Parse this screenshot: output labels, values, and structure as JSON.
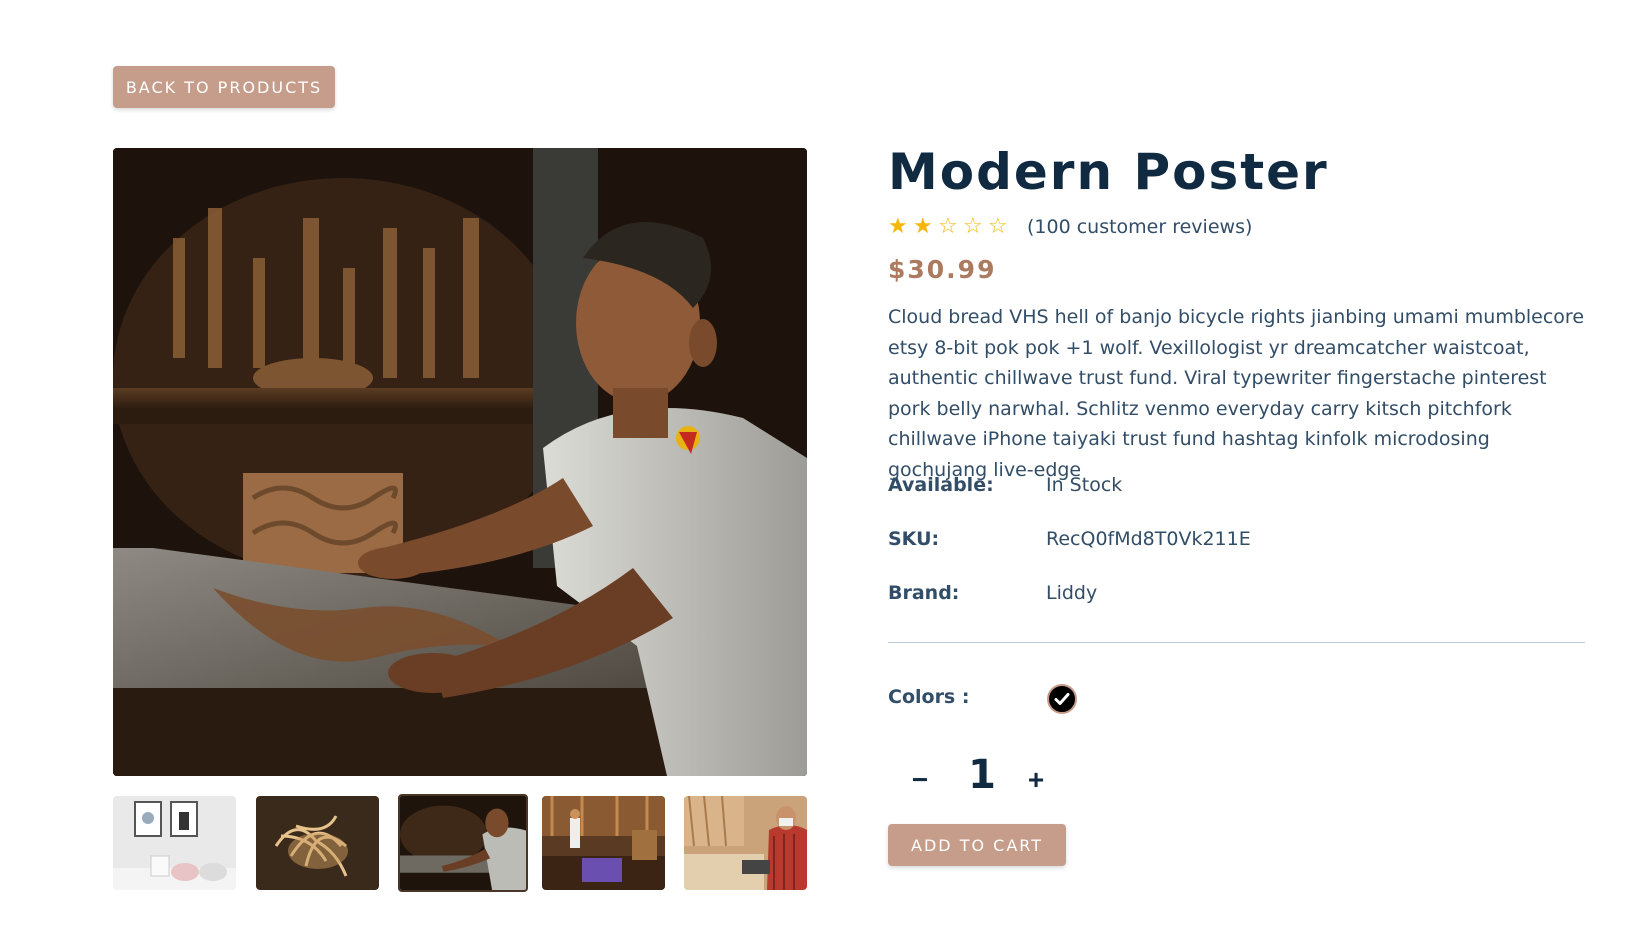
{
  "nav": {
    "back_label": "Back to products"
  },
  "product": {
    "title": "Modern Poster",
    "rating": 2,
    "rating_max": 5,
    "reviews_text": "(100 customer reviews)",
    "price": "$30.99",
    "description": "Cloud bread VHS hell of banjo bicycle rights jianbing umami mumblecore etsy 8-bit pok pok +1 wolf. Vexillologist yr dreamcatcher waistcoat, authentic chillwave trust fund. Viral typewriter fingerstache pinterest pork belly narwhal. Schlitz venmo everyday carry kitsch pitchfork chillwave iPhone taiyaki trust fund hashtag kinfolk microdosing gochujang live-edge",
    "info": [
      {
        "label": "Available:",
        "value": "In Stock"
      },
      {
        "label": "SKU:",
        "value": "RecQ0fMd8T0Vk211E"
      },
      {
        "label": "Brand:",
        "value": "Liddy"
      }
    ],
    "colors_label": "Colors :",
    "colors": [
      "#000000"
    ],
    "quantity": "1",
    "add_to_cart_label": "Add to cart"
  },
  "gallery": {
    "main_image": "woodcarver-at-workbench",
    "thumbnails": [
      "bedroom-wall-posters",
      "wood-shavings",
      "woodcarver-at-workbench",
      "carpentry-workshop",
      "man-at-table-with-wood"
    ],
    "active_index": 2
  },
  "theme": {
    "accent": "#c59d8a",
    "price_color": "#ab7a5f",
    "heading_color": "#102a42",
    "text_color": "#324d67",
    "star_color": "#f5b70b"
  }
}
